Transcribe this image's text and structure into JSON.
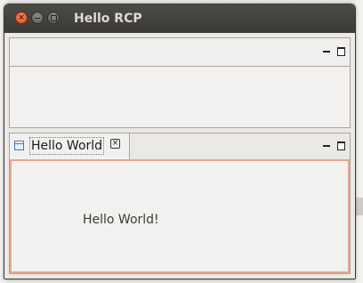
{
  "window": {
    "title": "Hello RCP",
    "close_glyph": "×",
    "controls": [
      "close-icon",
      "minimize-icon",
      "maximize-icon"
    ]
  },
  "top_view": {
    "controls": [
      "minimize-icon",
      "maximize-icon"
    ]
  },
  "editor": {
    "tab_label": "Hello World",
    "tab_icon": "view-icon",
    "tab_close_glyph": "×",
    "controls": [
      "minimize-icon",
      "maximize-icon"
    ],
    "content_text": "Hello World!"
  },
  "colors": {
    "titlebar": "#3b3a36",
    "close_button": "#df4a16",
    "active_border": "#e8a690",
    "title_text": "#dfdbd2"
  }
}
